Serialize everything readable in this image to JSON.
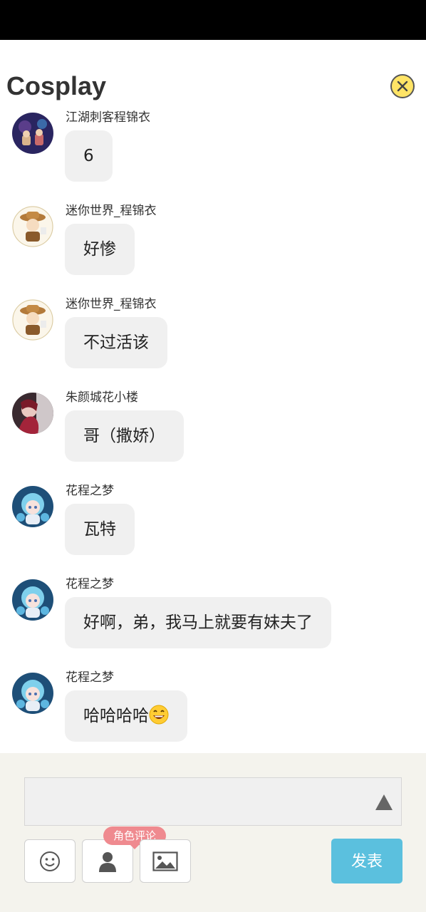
{
  "header": {
    "title": "Cosplay",
    "close_icon": "close-icon",
    "close_color": "#ffe466"
  },
  "messages": [
    {
      "user": "江湖刺客程锦衣",
      "text": "6",
      "avatar_icon": "avatar-dark-scene"
    },
    {
      "user": "迷你世界_程锦衣",
      "text": "好惨",
      "avatar_icon": "avatar-hat-character"
    },
    {
      "user": "迷你世界_程锦衣",
      "text": "不过活该",
      "avatar_icon": "avatar-hat-character"
    },
    {
      "user": "朱颜城花小楼",
      "text": "哥（撒娇）",
      "avatar_icon": "avatar-red-figure"
    },
    {
      "user": "花程之梦",
      "text": "瓦特",
      "avatar_icon": "avatar-blue-hair-girl"
    },
    {
      "user": "花程之梦",
      "text": "好啊，弟，我马上就要有妹夫了",
      "avatar_icon": "avatar-blue-hair-girl"
    },
    {
      "user": "花程之梦",
      "text": "哈哈哈哈",
      "emoji": "grinning-face-emoji",
      "avatar_icon": "avatar-blue-hair-girl"
    }
  ],
  "composer": {
    "input_value": "",
    "expand_icon": "triangle-up-icon",
    "tools": [
      "smiley-icon",
      "person-icon",
      "image-icon"
    ],
    "role_badge": "角色评论",
    "send_label": "发表",
    "send_color": "#5bc0de"
  }
}
